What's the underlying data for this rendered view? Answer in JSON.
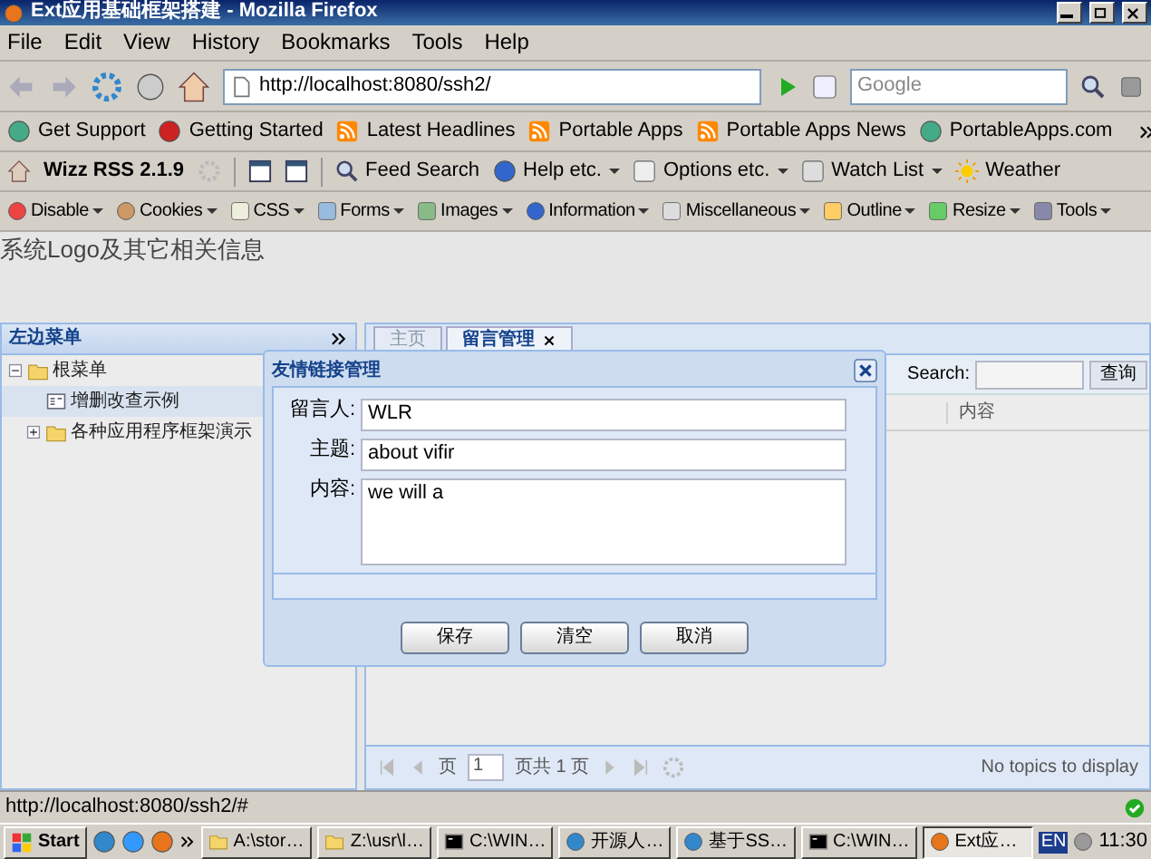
{
  "window": {
    "title": "Ext应用基础框架搭建 - Mozilla Firefox"
  },
  "menu_bar": [
    "File",
    "Edit",
    "View",
    "History",
    "Bookmarks",
    "Tools",
    "Help"
  ],
  "navigation": {
    "url": "http://localhost:8080/ssh2/",
    "search_placeholder": "Google"
  },
  "bookmarks": [
    "Get Support",
    "Getting Started",
    "Latest Headlines",
    "Portable Apps",
    "Portable Apps News",
    "PortableApps.com"
  ],
  "wizz_toolbar": {
    "title": "Wizz RSS 2.1.9",
    "items": [
      {
        "label": "Feed Search",
        "dropdown": false
      },
      {
        "label": "Help etc.",
        "dropdown": true
      },
      {
        "label": "Options etc.",
        "dropdown": true
      },
      {
        "label": "Watch List",
        "dropdown": true
      },
      {
        "label": "Weather",
        "dropdown": false
      }
    ]
  },
  "developer_toolbar": [
    {
      "label": "Disable"
    },
    {
      "label": "Cookies"
    },
    {
      "label": "CSS"
    },
    {
      "label": "Forms"
    },
    {
      "label": "Images"
    },
    {
      "label": "Information"
    },
    {
      "label": "Miscellaneous"
    },
    {
      "label": "Outline"
    },
    {
      "label": "Resize"
    },
    {
      "label": "Tools"
    }
  ],
  "page": {
    "header": "系统Logo及其它相关信息",
    "left_panel": {
      "title": "左边菜单",
      "tree": [
        {
          "label": "根菜单",
          "expanded": true,
          "selected": false,
          "children": [
            {
              "label": "增删改查示例",
              "selected": true
            },
            {
              "label": "各种应用程序框架演示",
              "expanded": false,
              "selected": false
            }
          ]
        }
      ]
    },
    "tabs": [
      {
        "label": "主页",
        "selected": false,
        "closable": false
      },
      {
        "label": "留言管理",
        "selected": true,
        "closable": true
      }
    ],
    "grid": {
      "search_label": "Search:",
      "search_button": "查询",
      "columns": [
        "内容"
      ]
    },
    "paging": {
      "page_label": "页",
      "page": "1",
      "total": "页共 1 页",
      "info": "No topics to display"
    }
  },
  "dialog": {
    "title": "友情链接管理",
    "fields": [
      {
        "kind": "text",
        "label": "留言人:",
        "value": "WLR"
      },
      {
        "kind": "text",
        "label": "主题:",
        "value": "about vifir"
      },
      {
        "kind": "textarea",
        "label": "内容:",
        "value": "we will a"
      }
    ],
    "buttons": [
      "保存",
      "清空",
      "取消"
    ]
  },
  "status_bar": {
    "text": "http://localhost:8080/ssh2/#"
  },
  "taskbar": {
    "start": "Start",
    "tasks": [
      {
        "label": "A:\\stor…",
        "selected": false
      },
      {
        "label": "Z:\\usr\\l…",
        "selected": false
      },
      {
        "label": "C:\\WIN…",
        "selected": false
      },
      {
        "label": "开源人…",
        "selected": false
      },
      {
        "label": "基于SS…",
        "selected": false
      },
      {
        "label": "C:\\WIN…",
        "selected": false
      },
      {
        "label": "Ext应…",
        "selected": true
      }
    ],
    "language": "EN",
    "clock": "11:30"
  }
}
